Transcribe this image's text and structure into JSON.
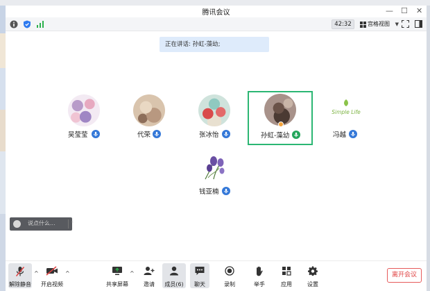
{
  "window": {
    "title": "腾讯会议"
  },
  "info_bar": {
    "timer": "42:32",
    "view_mode": "宫格视图"
  },
  "speaking": {
    "text": "正在讲话: 孙虹-藻幼;"
  },
  "participants": [
    {
      "name": "吴莹莹",
      "mic": "mic-icon",
      "active": false
    },
    {
      "name": "代荣",
      "mic": "mic-icon",
      "active": false
    },
    {
      "name": "张冰怡",
      "mic": "mic-icon",
      "active": false
    },
    {
      "name": "孙虹-藻幼",
      "mic": "speaking-mic-icon",
      "active": true
    },
    {
      "name": "冯越",
      "mic": "mic-icon",
      "active": false,
      "avatar_text": "Simple Life"
    },
    {
      "name": "钱亚楠",
      "mic": "mic-icon",
      "active": false
    }
  ],
  "chat": {
    "placeholder": "说点什么..."
  },
  "toolbar": {
    "unmute": "解除静音",
    "start_video": "开启视频",
    "share_screen": "共享屏幕",
    "invite": "邀请",
    "members": "成员(6)",
    "chat": "聊天",
    "record": "录制",
    "raise_hand": "举手",
    "apps": "应用",
    "settings": "设置",
    "leave": "离开会议"
  },
  "colors": {
    "accent_blue": "#3478d8",
    "active_green": "#2bb673",
    "leave_red": "#e04343",
    "banner_bg": "#deebfb"
  }
}
